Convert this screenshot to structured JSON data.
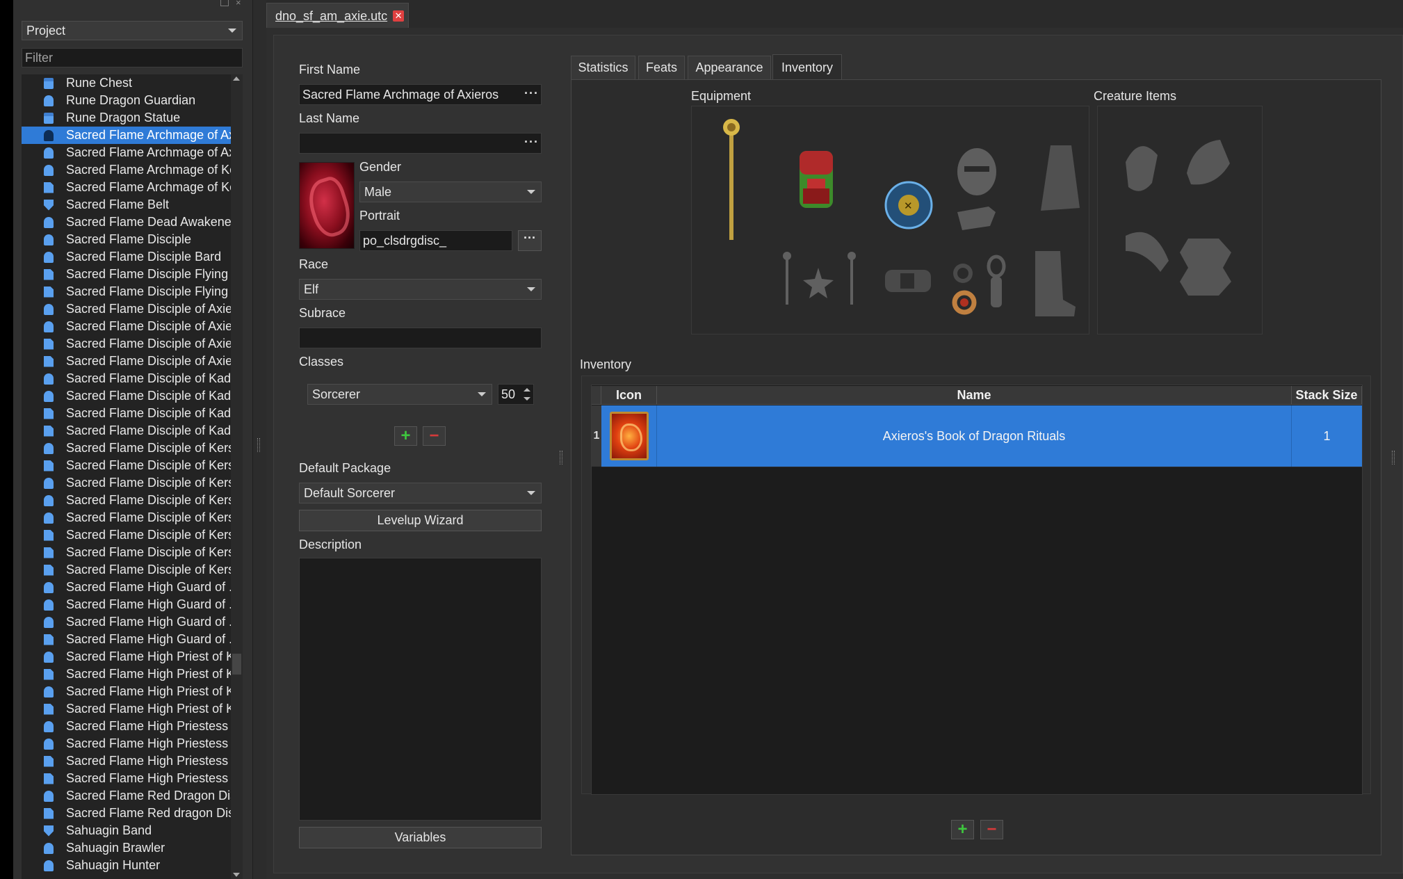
{
  "project_panel": {
    "combo_value": "Project",
    "filter_placeholder": "Filter",
    "items": [
      {
        "label": "Rune Chest",
        "icon": "chest-icon"
      },
      {
        "label": "Rune Dragon Guardian",
        "icon": "creature-icon"
      },
      {
        "label": "Rune Dragon Statue",
        "icon": "chest-icon"
      },
      {
        "label": "Sacred Flame Archmage of Ax...",
        "icon": "creature-icon",
        "selected": true
      },
      {
        "label": "Sacred Flame Archmage of Ax...",
        "icon": "creature-icon"
      },
      {
        "label": "Sacred Flame Archmage of Ke...",
        "icon": "creature-icon"
      },
      {
        "label": "Sacred Flame Archmage of Ke...",
        "icon": "document-icon"
      },
      {
        "label": "Sacred Flame Belt",
        "icon": "shield-icon"
      },
      {
        "label": "Sacred Flame Dead Awakene...",
        "icon": "creature-icon"
      },
      {
        "label": "Sacred Flame Disciple",
        "icon": "creature-icon"
      },
      {
        "label": "Sacred Flame Disciple Bard",
        "icon": "creature-icon"
      },
      {
        "label": "Sacred Flame Disciple Flying ...",
        "icon": "document-icon"
      },
      {
        "label": "Sacred Flame Disciple Flying ...",
        "icon": "document-icon"
      },
      {
        "label": "Sacred Flame Disciple of Axie...",
        "icon": "creature-icon"
      },
      {
        "label": "Sacred Flame Disciple of Axie...",
        "icon": "creature-icon"
      },
      {
        "label": "Sacred Flame Disciple of Axie...",
        "icon": "document-icon"
      },
      {
        "label": "Sacred Flame Disciple of Axie...",
        "icon": "document-icon"
      },
      {
        "label": "Sacred Flame Disciple of Kad...",
        "icon": "creature-icon"
      },
      {
        "label": "Sacred Flame Disciple of Kad...",
        "icon": "creature-icon"
      },
      {
        "label": "Sacred Flame Disciple of Kad...",
        "icon": "document-icon"
      },
      {
        "label": "Sacred Flame Disciple of Kad...",
        "icon": "document-icon"
      },
      {
        "label": "Sacred Flame Disciple of Kersa",
        "icon": "creature-icon"
      },
      {
        "label": "Sacred Flame Disciple of Kersa",
        "icon": "document-icon"
      },
      {
        "label": "Sacred Flame Disciple of Kers...",
        "icon": "creature-icon"
      },
      {
        "label": "Sacred Flame Disciple of Kers...",
        "icon": "creature-icon"
      },
      {
        "label": "Sacred Flame Disciple of Kers...",
        "icon": "creature-icon"
      },
      {
        "label": "Sacred Flame Disciple of Kers...",
        "icon": "document-icon"
      },
      {
        "label": "Sacred Flame Disciple of Kers...",
        "icon": "document-icon"
      },
      {
        "label": "Sacred Flame Disciple of Kers...",
        "icon": "document-icon"
      },
      {
        "label": "Sacred Flame High Guard of ...",
        "icon": "creature-icon"
      },
      {
        "label": "Sacred Flame High Guard of ...",
        "icon": "creature-icon"
      },
      {
        "label": "Sacred Flame High Guard of ...",
        "icon": "creature-icon"
      },
      {
        "label": "Sacred Flame High Guard of ...",
        "icon": "document-icon"
      },
      {
        "label": "Sacred Flame High Priest of K...",
        "icon": "creature-icon"
      },
      {
        "label": "Sacred Flame High Priest of K...",
        "icon": "document-icon"
      },
      {
        "label": "Sacred Flame High Priest of K...",
        "icon": "creature-icon"
      },
      {
        "label": "Sacred Flame High Priest of K...",
        "icon": "document-icon"
      },
      {
        "label": "Sacred Flame High Priestess ...",
        "icon": "creature-icon"
      },
      {
        "label": "Sacred Flame High Priestess ...",
        "icon": "creature-icon"
      },
      {
        "label": "Sacred Flame High Priestess ...",
        "icon": "document-icon"
      },
      {
        "label": "Sacred Flame High Priestess ...",
        "icon": "document-icon"
      },
      {
        "label": "Sacred Flame Red Dragon Dis...",
        "icon": "creature-icon"
      },
      {
        "label": "Sacred Flame Red dragon Dis...",
        "icon": "document-icon"
      },
      {
        "label": "Sahuagin Band",
        "icon": "shield-icon"
      },
      {
        "label": "Sahuagin Brawler",
        "icon": "creature-icon"
      },
      {
        "label": "Sahuagin Hunter",
        "icon": "creature-icon"
      }
    ]
  },
  "document_tab": {
    "label": "dno_sf_am_axie.utc",
    "close_glyph": "✕"
  },
  "basic": {
    "first_name_label": "First Name",
    "first_name_value": "Sacred Flame Archmage of Axieros",
    "last_name_label": "Last Name",
    "last_name_value": "",
    "gender_label": "Gender",
    "gender_value": "Male",
    "portrait_label": "Portrait",
    "portrait_value": "po_clsdrgdisc_",
    "race_label": "Race",
    "race_value": "Elf",
    "subrace_label": "Subrace",
    "subrace_value": "",
    "classes_label": "Classes",
    "class_value": "Sorcerer",
    "class_level": "50",
    "default_package_label": "Default Package",
    "default_package_value": "Default Sorcerer",
    "levelup_wizard_label": "Levelup Wizard",
    "description_label": "Description",
    "description_value": "",
    "variables_label": "Variables",
    "add_glyph": "+",
    "remove_glyph": "−"
  },
  "tabs": [
    {
      "label": "Statistics"
    },
    {
      "label": "Feats"
    },
    {
      "label": "Appearance"
    },
    {
      "label": "Inventory",
      "active": true
    }
  ],
  "inventory": {
    "equipment_label": "Equipment",
    "creature_items_label": "Creature Items",
    "inventory_label": "Inventory",
    "columns": [
      "Icon",
      "Name",
      "Stack Size"
    ],
    "rows": [
      {
        "index": "1",
        "name": "Axieros's Book of Dragon Rituals",
        "stack": "1"
      }
    ]
  },
  "colors": {
    "selection": "#2f7bd7",
    "add": "#3ec73e",
    "remove": "#d53a3a"
  }
}
